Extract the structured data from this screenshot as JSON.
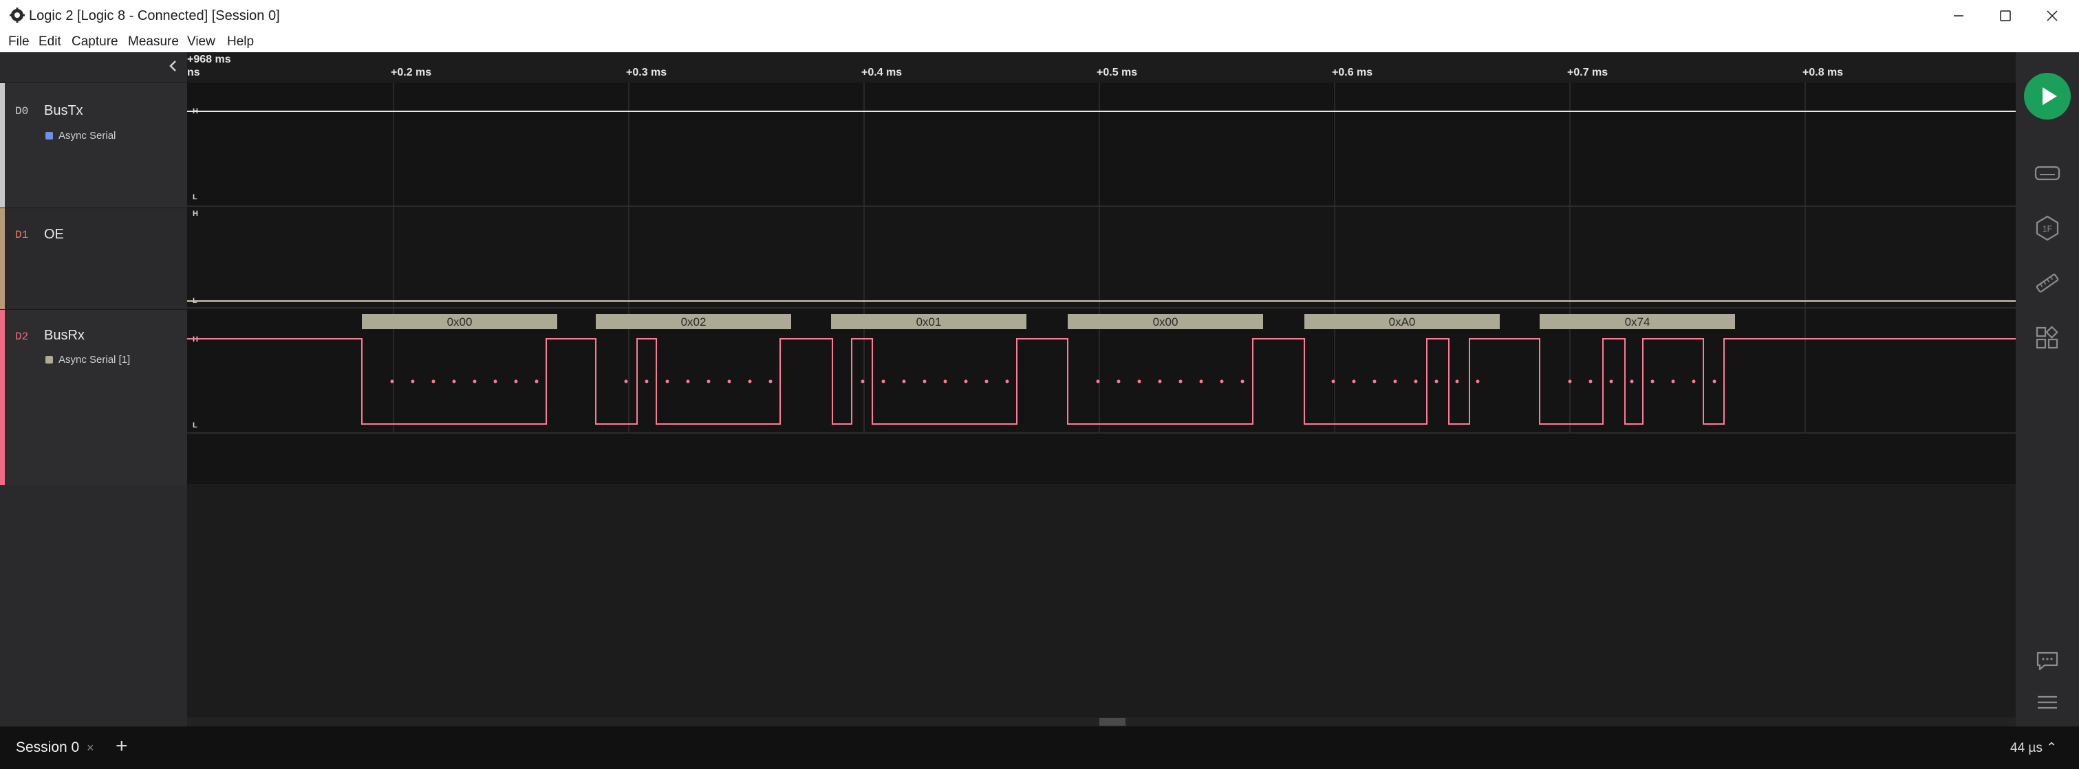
{
  "window": {
    "title": "Logic 2 [Logic 8 - Connected] [Session 0]"
  },
  "menu": [
    "File",
    "Edit",
    "Capture",
    "Measure",
    "View",
    "Help"
  ],
  "channels": [
    {
      "id": "D0",
      "name": "BusTx",
      "analyzer": "Async Serial",
      "strip_color": "#c8c8c8",
      "id_color": "#cfcfcf",
      "analyzer_color": "#6f8fe8"
    },
    {
      "id": "D1",
      "name": "OE",
      "analyzer": "",
      "strip_color": "#b89a7a",
      "id_color": "#e57c6a",
      "analyzer_color": ""
    },
    {
      "id": "D2",
      "name": "BusRx",
      "analyzer": "Async Serial [1]",
      "strip_color": "#ee6b86",
      "id_color": "#ee6b86",
      "analyzer_color": "#b0ac90"
    }
  ],
  "ruler": {
    "origin_label": "+968 ms",
    "origin_unit": "ns",
    "ticks": [
      "+0.2 ms",
      "+0.3 ms",
      "+0.4 ms",
      "+0.5 ms",
      "+0.6 ms",
      "+0.7 ms",
      "+0.8 ms"
    ]
  },
  "levels": {
    "high": "H",
    "low": "L"
  },
  "decoded_frames": [
    "0x00",
    "0x02",
    "0x01",
    "0x00",
    "0xA0",
    "0x74"
  ],
  "colors": {
    "d0_trace": "#e8e8e8",
    "d1_trace": "#d6c9a6",
    "d2_trace": "#ff7a94",
    "frame_fill": "#aca995",
    "run_button": "#1aa05a"
  },
  "rail": {
    "icons": [
      "analyzers-icon",
      "hex-1f-icon",
      "ruler-icon",
      "extensions-icon",
      "chat-icon",
      "menu-icon"
    ]
  },
  "bottom": {
    "session_label": "Session 0",
    "close_glyph": "×",
    "add_glyph": "+",
    "timing_readout": "44 µs ⌃"
  }
}
